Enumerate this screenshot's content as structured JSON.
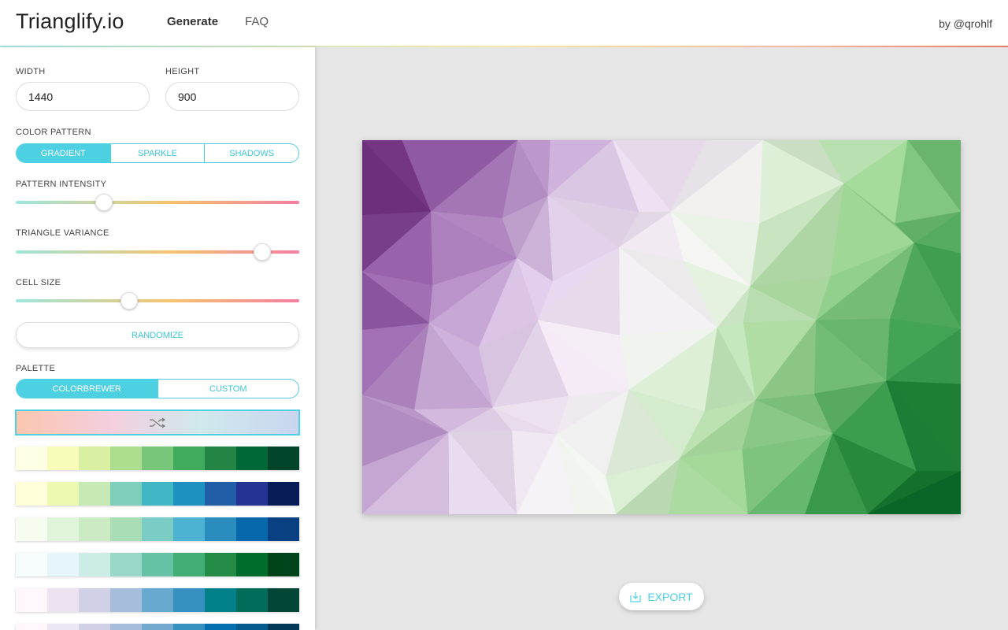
{
  "header": {
    "logo": "Trianglify.io",
    "nav": [
      {
        "label": "Generate"
      },
      {
        "label": "FAQ"
      }
    ],
    "byline": "by @qrohlf"
  },
  "sidebar": {
    "width_label": "WIDTH",
    "width_value": "1440",
    "height_label": "HEIGHT",
    "height_value": "900",
    "color_pattern_label": "COLOR PATTERN",
    "color_pattern_options": [
      "GRADIENT",
      "SPARKLE",
      "SHADOWS"
    ],
    "color_pattern_selected": "GRADIENT",
    "intensity_label": "PATTERN INTENSITY",
    "intensity_value": 0.31,
    "variance_label": "TRIANGLE VARIANCE",
    "variance_value": 0.87,
    "cell_size_label": "CELL SIZE",
    "cell_size_value": 0.4,
    "randomize_label": "RANDOMIZE",
    "palette_label": "PALETTE",
    "palette_options": [
      "COLORBREWER",
      "CUSTOM"
    ],
    "palette_selected": "COLORBREWER",
    "custom_palette_icon": "shuffle-icon",
    "palettes": [
      [
        "#ffffe5",
        "#f7fcb9",
        "#d9f0a3",
        "#addd8e",
        "#78c679",
        "#41ab5d",
        "#238443",
        "#006837",
        "#004529"
      ],
      [
        "#ffffd9",
        "#edf8b1",
        "#c7e9b4",
        "#7fcdbb",
        "#41b6c4",
        "#1d91c0",
        "#225ea8",
        "#253494",
        "#081d58"
      ],
      [
        "#f7fcf0",
        "#e0f3db",
        "#ccebc5",
        "#a8ddb5",
        "#7bccc4",
        "#4eb3d3",
        "#2b8cbe",
        "#0868ac",
        "#084081"
      ],
      [
        "#f7fcfd",
        "#e5f5f9",
        "#ccece6",
        "#99d8c9",
        "#66c2a4",
        "#41ae76",
        "#238b45",
        "#006d2c",
        "#00441b"
      ],
      [
        "#fff7fb",
        "#ece2f0",
        "#d0d1e6",
        "#a6bddb",
        "#67a9cf",
        "#3690c0",
        "#02818a",
        "#016c59",
        "#014636"
      ],
      [
        "#fff7fb",
        "#ece7f2",
        "#d0d1e6",
        "#a6bddb",
        "#74a9cf",
        "#3690c0",
        "#0570b0",
        "#045a8d",
        "#023858"
      ]
    ]
  },
  "main": {
    "export_label": "EXPORT",
    "export_icon": "download-icon",
    "preview_colors": [
      "#5a1466",
      "#9c6bb0",
      "#e2d0ea",
      "#f2f2f0",
      "#a6d89a",
      "#3a9c4c",
      "#005a20"
    ]
  }
}
